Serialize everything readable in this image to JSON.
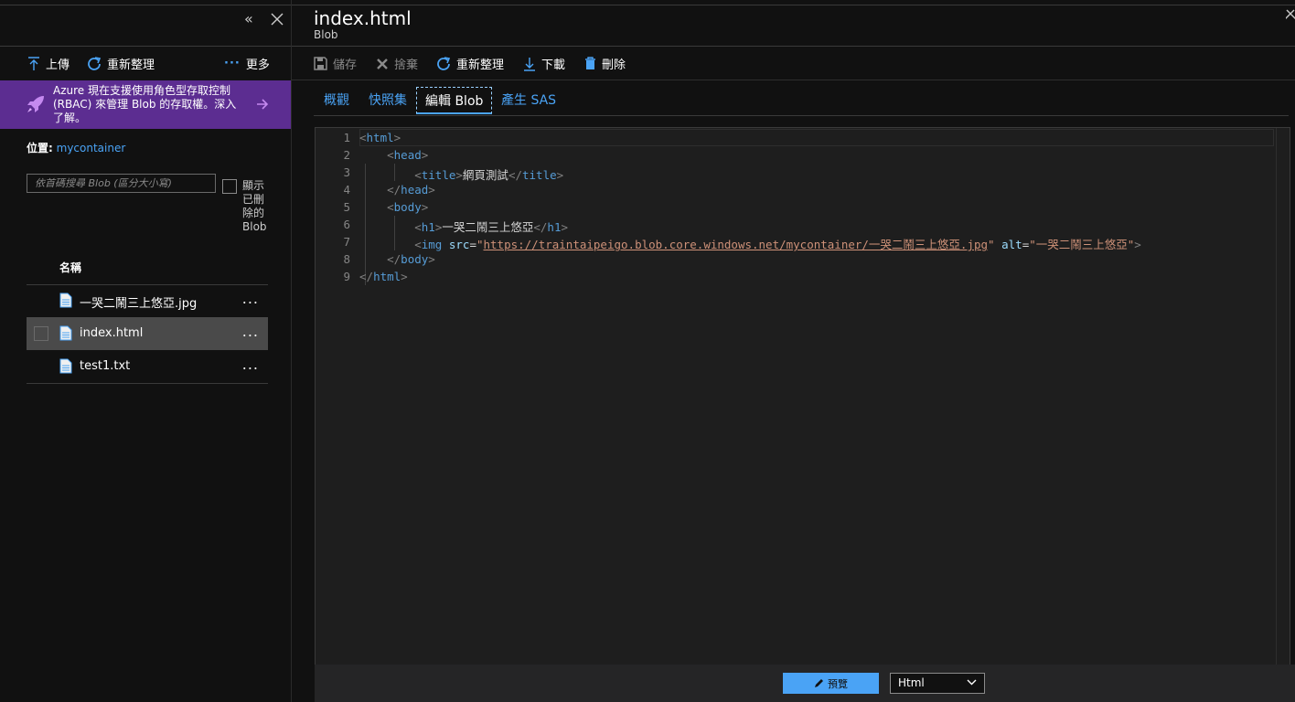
{
  "left_pane": {
    "toolbar": {
      "upload_label": "上傳",
      "refresh_label": "重新整理",
      "more_label": "更多"
    },
    "banner": {
      "text": "Azure 現在支援使用角色型存取控制 (RBAC) 來管理 Blob 的存取權。深入了解。"
    },
    "location": {
      "label": "位置:",
      "value": "mycontainer"
    },
    "search": {
      "placeholder": "依首碼搜尋 Blob (區分大小寫)"
    },
    "show_deleted_label": "顯示已刪除的Blob",
    "column_header": "名稱",
    "rows": [
      {
        "name": "一哭二鬧三上悠亞.jpg",
        "more": "..."
      },
      {
        "name": "index.html",
        "more": "..."
      },
      {
        "name": "test1.txt",
        "more": "..."
      }
    ]
  },
  "right_pane": {
    "title": "index.html",
    "subtitle": "Blob",
    "toolbar": {
      "save_label": "儲存",
      "discard_label": "捨棄",
      "refresh_label": "重新整理",
      "download_label": "下載",
      "delete_label": "刪除"
    },
    "tabs": [
      {
        "label": "概觀"
      },
      {
        "label": "快照集"
      },
      {
        "label": "編輯 Blob"
      },
      {
        "label": "產生 SAS"
      }
    ],
    "editor": {
      "line_numbers": [
        "1",
        "2",
        "3",
        "4",
        "5",
        "6",
        "7",
        "8",
        "9"
      ],
      "title_text": "網頁測試",
      "h1_text": "一哭二鬧三上悠亞",
      "img_src": "https://traintaipeigo.blob.core.windows.net/mycontainer/一哭二鬧三上悠亞.jpg",
      "img_alt": "一哭二鬧三上悠亞"
    },
    "footer": {
      "preview_label": "預覽",
      "language_value": "Html"
    }
  },
  "colors": {
    "accent": "#4aa3f5",
    "banner": "#5c2d91",
    "background": "#111111",
    "editor_bg": "#1e1e1e"
  },
  "icons": [
    "collapse-icon",
    "close-icon",
    "upload-icon",
    "refresh-icon",
    "more-icon",
    "rocket-icon",
    "arrow-right-icon",
    "file-icon",
    "save-icon",
    "discard-icon",
    "download-icon",
    "delete-icon",
    "pencil-icon",
    "chevron-down-icon"
  ]
}
